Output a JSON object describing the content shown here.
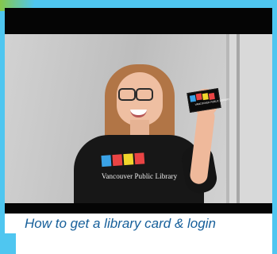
{
  "video": {
    "shirt_text": "Vancouver Public Library",
    "card_text": "VANCOUVER PUBLIC LIBRARY"
  },
  "caption": {
    "text": "How to get a library card & login"
  },
  "colors": {
    "background": "#4fc6f0",
    "caption": "#165f9a",
    "blue_block": "#3aa2e6",
    "red_block": "#e94444",
    "yellow_block": "#f0d52c"
  }
}
